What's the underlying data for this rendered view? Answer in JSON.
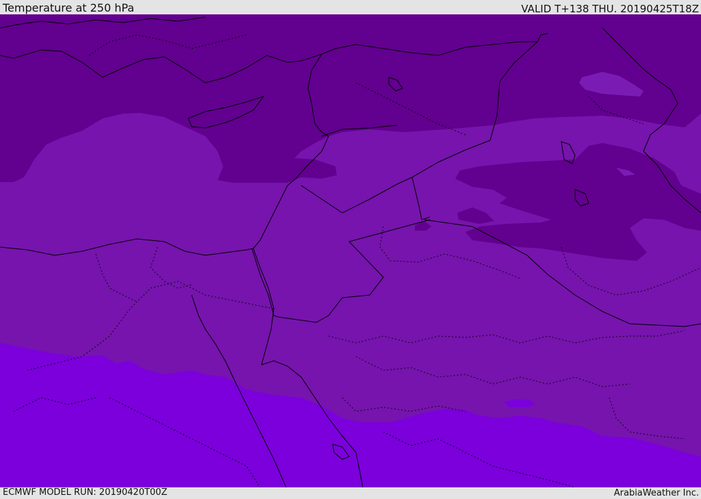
{
  "header": {
    "title": "Temperature at 250 hPa",
    "valid_time": "VALID T+138 THU. 20190425T18Z"
  },
  "footer": {
    "model_run": "ECMWF MODEL RUN: 20190420T00Z",
    "credit": "ArabiaWeather Inc."
  },
  "map": {
    "colors": {
      "coldest_band": "#62008f",
      "mid_band": "#7614ad",
      "warm_band": "#7b00dc",
      "border_line": "#000000"
    }
  }
}
